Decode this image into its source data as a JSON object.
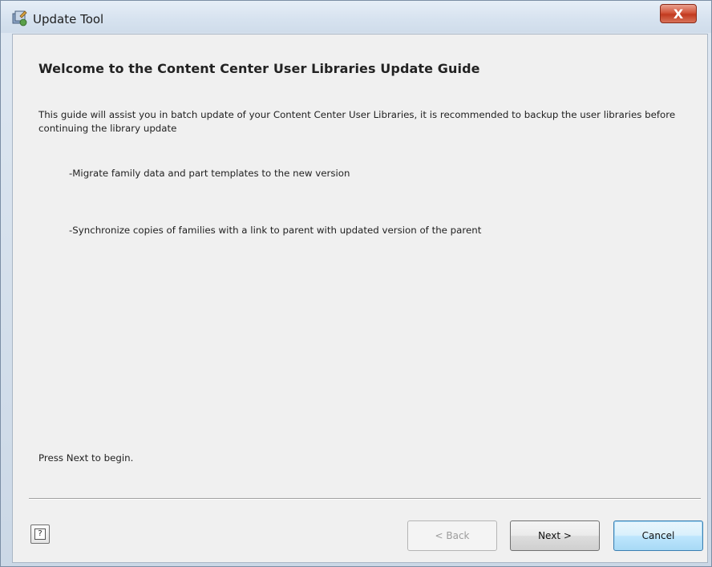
{
  "window": {
    "title": "Update Tool",
    "close_label": "X",
    "app_icon": "update-tool-icon"
  },
  "content": {
    "heading": "Welcome to the Content Center User Libraries Update Guide",
    "intro": "This guide will assist you in batch update of your Content Center User Libraries, it is recommended to backup the user libraries before continuing the library update",
    "bullets": [
      "-Migrate family data and part templates to the new version",
      "-Synchronize copies of families with a link to parent with updated version of the parent"
    ],
    "press_next": "Press Next to begin."
  },
  "footer": {
    "help_glyph": "?",
    "back_label": "< Back",
    "back_enabled": false,
    "next_label": "Next >",
    "cancel_label": "Cancel",
    "default_button": "Cancel"
  },
  "colors": {
    "close_button": "#c23a1f",
    "default_button_border": "#3c7fb1",
    "dialog_background": "#f0f0f0"
  }
}
